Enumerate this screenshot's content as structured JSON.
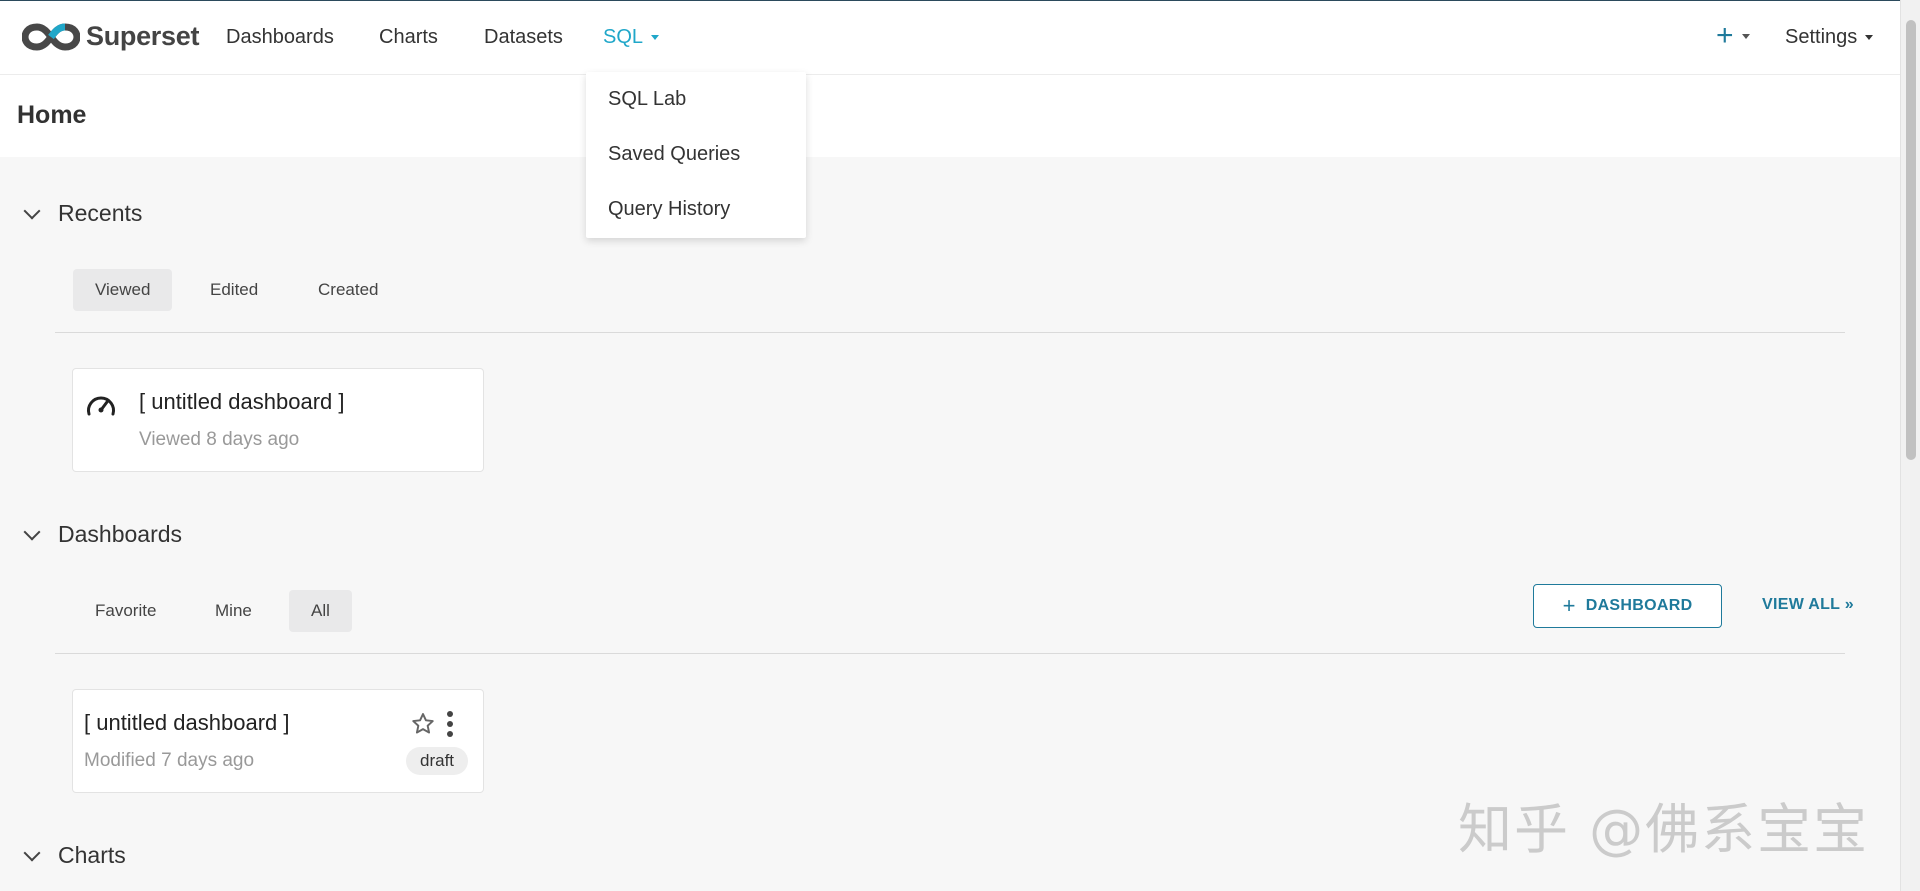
{
  "brand": {
    "name": "Superset"
  },
  "nav": {
    "items": [
      "Dashboards",
      "Charts",
      "Datasets"
    ],
    "sql_label": "SQL",
    "plus_label": "+",
    "settings_label": "Settings"
  },
  "sql_menu": {
    "items": [
      "SQL Lab",
      "Saved Queries",
      "Query History"
    ]
  },
  "page": {
    "title": "Home"
  },
  "recents": {
    "title": "Recents",
    "tabs": [
      "Viewed",
      "Edited",
      "Created"
    ],
    "active_tab": "Viewed",
    "card": {
      "title": "[ untitled dashboard ]",
      "subtitle": "Viewed 8 days ago",
      "icon": "dashboard-gauge-icon"
    }
  },
  "dashboards": {
    "title": "Dashboards",
    "tabs": [
      "Favorite",
      "Mine",
      "All"
    ],
    "active_tab": "All",
    "add_button": "DASHBOARD",
    "view_all": "VIEW ALL »",
    "card": {
      "title": "[ untitled dashboard ]",
      "subtitle": "Modified 7 days ago",
      "badge": "draft"
    }
  },
  "charts": {
    "title": "Charts"
  },
  "watermark": "知乎 @佛系宝宝",
  "colors": {
    "accent": "#1f7a9b",
    "sql_active": "#20a7c9"
  }
}
